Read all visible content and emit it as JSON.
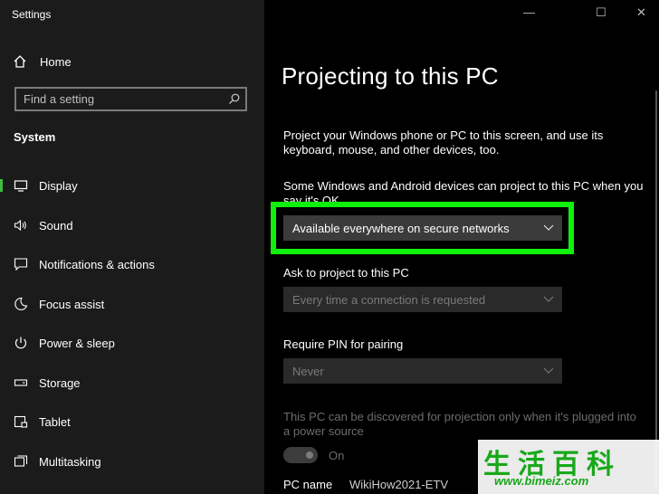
{
  "window": {
    "title": "Settings",
    "controls": {
      "minimize": "—",
      "maximize": "☐",
      "close": "✕"
    }
  },
  "sidebar": {
    "home_label": "Home",
    "search_placeholder": "Find a setting",
    "section": "System",
    "items": [
      {
        "label": "Display",
        "icon": "display-icon"
      },
      {
        "label": "Sound",
        "icon": "speaker-icon"
      },
      {
        "label": "Notifications & actions",
        "icon": "notification-icon"
      },
      {
        "label": "Focus assist",
        "icon": "moon-icon"
      },
      {
        "label": "Power & sleep",
        "icon": "power-icon"
      },
      {
        "label": "Storage",
        "icon": "storage-icon"
      },
      {
        "label": "Tablet",
        "icon": "tablet-icon"
      },
      {
        "label": "Multitasking",
        "icon": "multitasking-icon"
      }
    ]
  },
  "main": {
    "title": "Projecting to this PC",
    "intro_line1": "Project your Windows phone or PC to this screen, and use its",
    "intro_line2": "keyboard, mouse, and other devices, too.",
    "some_line1": "Some Windows and Android devices can project to this PC when you",
    "some_line2": "say it's OK",
    "availability_value": "Available everywhere on secure networks",
    "ask_label": "Ask to project to this PC",
    "ask_value": "Every time a connection is requested",
    "pin_label": "Require PIN for pairing",
    "pin_value": "Never",
    "power_line1": "This PC can be discovered for projection only when it's plugged into",
    "power_line2": "a power source",
    "toggle_label": "On",
    "pcname_label": "PC name",
    "pcname_value": "WikiHow2021-ETV"
  },
  "watermark": {
    "chars": "生活百科",
    "url": "www.bimeiz.com"
  },
  "colors": {
    "sidebar_bg": "#1b1b1b",
    "main_bg": "#000000",
    "highlight": "#0ff00c",
    "accent": "#3fbf3f"
  }
}
